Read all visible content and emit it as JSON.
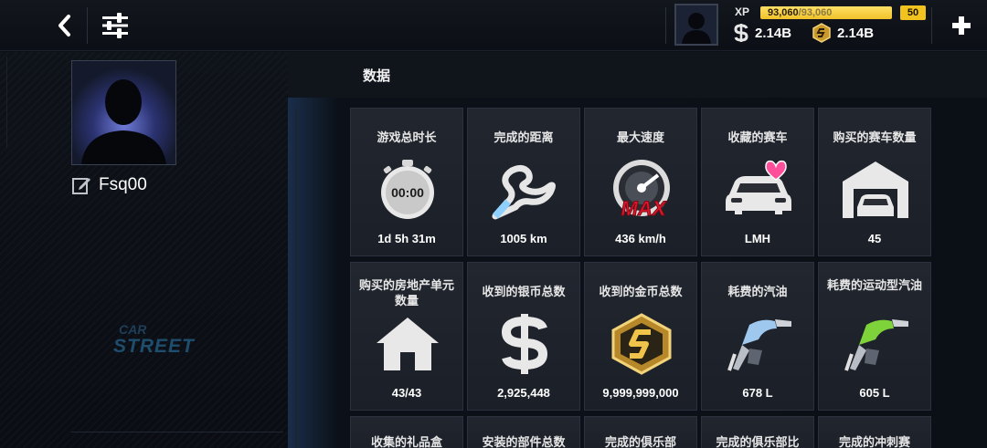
{
  "header": {
    "back_icon": "chevron-left-icon",
    "filter_icon": "sliders-icon",
    "xp_label": "XP",
    "xp_current": "93,060",
    "xp_max": "/93,060",
    "xp_progress": 1.0,
    "level": "50",
    "silver_amount": "2.14B",
    "gold_amount": "2.14B",
    "plus_icon": "plus-icon"
  },
  "profile": {
    "username": "Fsq00",
    "edit_icon": "edit-icon",
    "logo_text_top": "CAR",
    "logo_text_bottom": "STREET"
  },
  "stats_panel": {
    "title": "数据",
    "cards": [
      {
        "title": "游戏总时长",
        "value": "1d 5h 31m",
        "icon": "stopwatch-icon",
        "icon_text": "00:00"
      },
      {
        "title": "完成的距离",
        "value": "1005 km",
        "icon": "race-track-icon"
      },
      {
        "title": "最大速度",
        "value": "436 km/h",
        "icon": "speedometer-max-icon",
        "icon_text": "MAX"
      },
      {
        "title": "收藏的赛车",
        "value": "LMH",
        "icon": "car-heart-icon"
      },
      {
        "title": "购买的赛车数量",
        "value": "45",
        "icon": "garage-icon"
      },
      {
        "title": "购买的房地产单元数量",
        "value": "43/43",
        "icon": "house-icon"
      },
      {
        "title": "收到的银币总数",
        "value": "2,925,448",
        "icon": "silver-coin-icon"
      },
      {
        "title": "收到的金币总数",
        "value": "9,999,999,000",
        "icon": "gold-coin-icon"
      },
      {
        "title": "耗费的汽油",
        "value": "678 L",
        "icon": "fuel-nozzle-blue-icon"
      },
      {
        "title": "耗费的运动型汽油",
        "value": "605 L",
        "icon": "fuel-nozzle-green-icon"
      },
      {
        "title": "收集的礼品盒"
      },
      {
        "title": "安装的部件总数"
      },
      {
        "title": "完成的俱乐部"
      },
      {
        "title": "完成的俱乐部比"
      },
      {
        "title": "完成的冲刺赛"
      }
    ]
  },
  "colors": {
    "accent_gold": "#f2c21e",
    "card_bg": "#1e222b",
    "heart_pink": "#ff4f9a",
    "max_red": "#e0162c"
  }
}
